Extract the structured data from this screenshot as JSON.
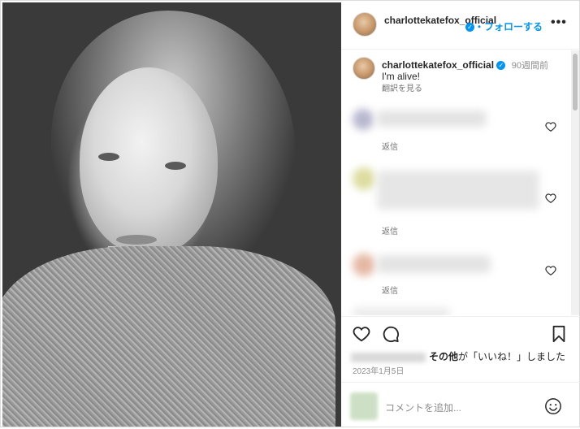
{
  "post_header": {
    "username": "charlottekatefox_official",
    "follow_label": "・フォローする",
    "more_label": "•••"
  },
  "caption": {
    "username": "charlottekatefox_official",
    "time": "90週間前",
    "text": "I'm alive!",
    "translate_label": "翻訳を見る"
  },
  "comments": [
    {
      "reply_label": "返信"
    },
    {
      "reply_label": "返信"
    },
    {
      "reply_label": "返信"
    }
  ],
  "likes": {
    "others_label": "その他",
    "suffix": "が「いいね！」しました"
  },
  "date": "2023年1月5日",
  "add_comment": {
    "placeholder": "コメントを追加..."
  },
  "colors": {
    "accent": "#0095f6",
    "muted": "#8e8e8e"
  }
}
